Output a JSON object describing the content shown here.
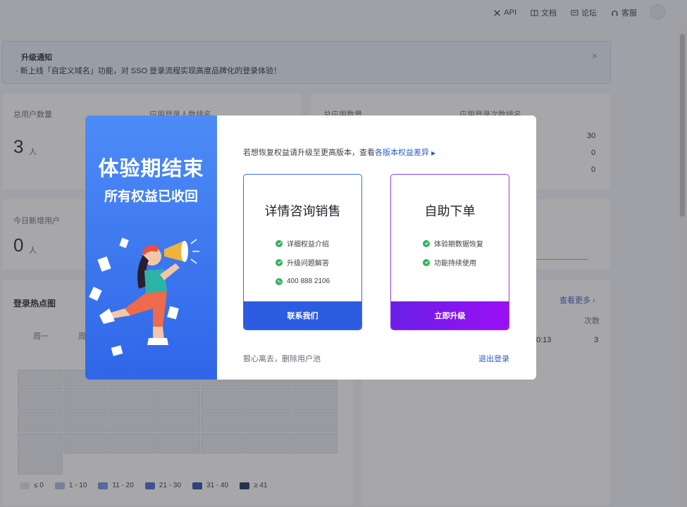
{
  "topnav": {
    "items": [
      {
        "label": "API",
        "icon": "tools-icon"
      },
      {
        "label": "文档",
        "icon": "book-icon"
      },
      {
        "label": "论坛",
        "icon": "forum-icon"
      },
      {
        "label": "客服",
        "icon": "headset-icon"
      }
    ]
  },
  "notice": {
    "title": "升级通知",
    "text": "新上线「自定义域名」功能，对 SSO 登录流程实现高度品牌化的登录体验！",
    "close": "×"
  },
  "stats": {
    "total_users_label": "总用户数量",
    "total_users_value": "3",
    "total_users_unit": "人",
    "app_login_rank_label": "应用登录人数排名",
    "total_apps_label": "总应用数量",
    "app_login_count_rank_label": "应用登录次数排名",
    "rank_values": [
      "30",
      "0",
      "0"
    ],
    "new_users_label": "今日新增用户",
    "new_users_value": "0",
    "new_users_unit": "人"
  },
  "heatmap": {
    "title": "登录热点图",
    "days": [
      "周一",
      "周"
    ],
    "legend": [
      "≤ 0",
      "1 - 10",
      "11 - 20",
      "21 - 30",
      "31 - 40",
      "≥ 41"
    ],
    "legend_colors": [
      "#e1e4ea",
      "#aab8e3",
      "#7090dc",
      "#3d63cf",
      "#2a45a3",
      "#18285e"
    ]
  },
  "recent": {
    "view_more": "查看更多 ›",
    "count_header": "次数",
    "row_time": "0:13",
    "row_count": "3"
  },
  "modal": {
    "heading": "体验期结束",
    "subheading": "所有权益已收回",
    "hint_prefix": "若想恢复权益请升级至更高版本，查看",
    "hint_link": "各版本权益差异",
    "sales": {
      "title": "详情咨询销售",
      "features": [
        "详细权益介绍",
        "升级问题解答",
        "400 888 2106"
      ],
      "button": "联系我们"
    },
    "self_serve": {
      "title": "自助下单",
      "features": [
        "体验期数据恢复",
        "功能持续使用"
      ],
      "button": "立即升级"
    },
    "footer_left": "狠心离去，删除用户池",
    "footer_right": "退出登录"
  },
  "colors": {
    "primary": "#2c5ce0",
    "upgrade_start": "#6a1fe6",
    "upgrade_end": "#9a10f5",
    "check_green": "#2fb35a",
    "panel_blue": "#3a72ef"
  }
}
